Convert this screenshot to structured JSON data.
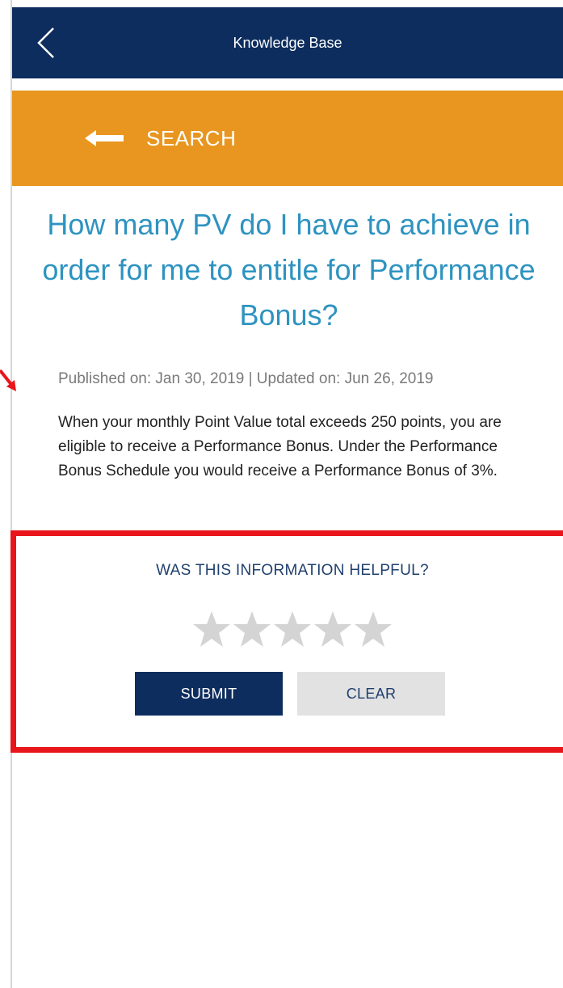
{
  "header": {
    "title": "Knowledge Base",
    "back_icon": "chevron-left-icon"
  },
  "search": {
    "label": "SEARCH",
    "icon": "arrow-left-icon"
  },
  "article": {
    "question": "How many PV do I have to achieve in order for me to entitle for Performance Bonus?",
    "dates": "Published on: Jan 30, 2019 | Updated on: Jun 26, 2019",
    "answer": "When your monthly Point Value total exceeds 250 points, you are eligible to receive a Performance Bonus. Under the Performance Bonus Schedule you would receive a Performance Bonus of 3%."
  },
  "feedback": {
    "title": "WAS THIS INFORMATION HELPFUL?",
    "rating": 0,
    "max_rating": 5,
    "submit_label": "SUBMIT",
    "clear_label": "CLEAR"
  },
  "colors": {
    "header_bg": "#0d2d5e",
    "search_bg": "#e8961f",
    "question_text": "#2e93c0",
    "highlight_border": "#e8151b",
    "star_empty": "#d4d4d4"
  }
}
